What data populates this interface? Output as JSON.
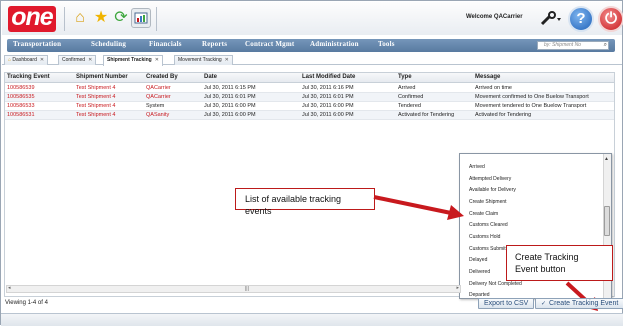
{
  "header": {
    "logo_text": "one",
    "welcome_text": "Welcome QACarrier",
    "help_glyph": "?",
    "quick_icons": [
      "home-icon",
      "star-icon",
      "refresh-icon",
      "report-icon"
    ]
  },
  "nav": {
    "items": [
      "Transportation",
      "Scheduling",
      "Financials",
      "Reports",
      "Contract Mgmt",
      "Administration",
      "Tools"
    ],
    "search_placeholder": "by: Shipment No"
  },
  "tabs": [
    {
      "label": "Dashboard",
      "active": false
    },
    {
      "label": "Confirmed",
      "active": false
    },
    {
      "label": "Shipment Tracking",
      "active": true
    },
    {
      "label": "Movement Tracking",
      "active": false
    }
  ],
  "table": {
    "columns": [
      "Tracking Event",
      "Shipment Number",
      "Created By",
      "Date",
      "Last Modified Date",
      "Type",
      "Message"
    ],
    "rows": [
      [
        "100586539",
        "Test Shipment 4",
        "QACarrier",
        "Jul 30, 2011 6:15 PM",
        "Jul 30, 2011 6:16 PM",
        "Arrived",
        "Arrived on time"
      ],
      [
        "100586535",
        "Test Shipment 4",
        "QACarrier",
        "Jul 30, 2011 6:01 PM",
        "Jul 30, 2011 6:01 PM",
        "Confirmed",
        "Movement confirmed to One Buelow Transport"
      ],
      [
        "100586533",
        "Test Shipment 4",
        "System",
        "Jul 30, 2011 6:00 PM",
        "Jul 30, 2011 6:00 PM",
        "Tendered",
        "Movement tendered to One Buelow Transport"
      ],
      [
        "100586531",
        "Test Shipment 4",
        "QASanity",
        "Jul 30, 2011 6:00 PM",
        "Jul 30, 2011 6:00 PM",
        "Activated for Tendering",
        "Activated for Tendering"
      ]
    ]
  },
  "dropdown": {
    "items": [
      "Arrived",
      "Attempted Delivery",
      "Available for Delivery",
      "Create Shipment",
      "Create Claim",
      "Customs Cleared",
      "Customs Hold",
      "Customs Submitted",
      "Delayed",
      "Delivered",
      "Delivery Not Completed",
      "Departed"
    ]
  },
  "callouts": {
    "list_label": "List of available tracking events",
    "button_label": "Create Tracking Event button"
  },
  "footer": {
    "viewing_text": "Viewing 1-4 of 4",
    "export_label": "Export to CSV",
    "create_label": "Create Tracking Event"
  },
  "colors": {
    "brand_red": "#e0192c",
    "nav_blue": "#587aa0",
    "link_red": "#c8191e",
    "callout_border": "#bc1a1a"
  }
}
